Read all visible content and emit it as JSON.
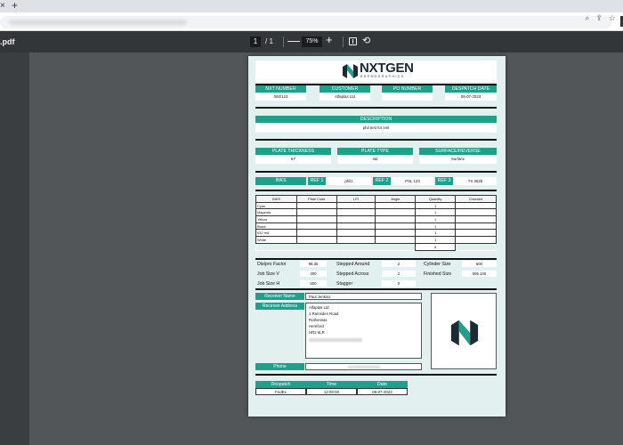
{
  "browser": {
    "new_tab_glyph": "+",
    "close_glyph": "×",
    "icons": [
      "zoom-icon",
      "share-icon",
      "star-icon"
    ]
  },
  "pdf_toolbar": {
    "file_name": ".pdf",
    "page_current": "1",
    "page_total": "/ 1",
    "zoom_minus": "—",
    "zoom_level": "75%",
    "zoom_plus": "+"
  },
  "document": {
    "brand": {
      "name": "NXTGEN",
      "tagline": "REPROGRAPHICS"
    },
    "header_fields": [
      {
        "label": "NXT NUMBER",
        "value": "000/123"
      },
      {
        "label": "CUSTOMER",
        "value": "Alfaplas Ltd"
      },
      {
        "label": "PO NUMBER",
        "value": ""
      },
      {
        "label": "DESPATCH DATE",
        "value": "06-07-2023"
      }
    ],
    "description": {
      "label": "DESCRIPTION",
      "value": "phil test for xml"
    },
    "plate_fields": [
      {
        "label": "PLATE THICKNESS",
        "value": "67"
      },
      {
        "label": "PLATE TYPE",
        "value": "std"
      },
      {
        "label": "SURFACE/REVERSE",
        "value": "Surface"
      }
    ],
    "inks_bar": {
      "label": "INKS",
      "refs": [
        {
          "label": "REF 1",
          "value": "phil1"
        },
        {
          "label": "REF 2",
          "value": "PSL 123"
        },
        {
          "label": "REF 3",
          "value": "TX 3625"
        }
      ]
    },
    "inks_table": {
      "headers": [
        "INKS",
        "Plate Code",
        "LPI",
        "Angle",
        "Quantity",
        "Checked"
      ],
      "rows": [
        [
          "Cyan",
          "",
          "",
          "",
          "1",
          ""
        ],
        [
          "Magenta",
          "",
          "",
          "",
          "1",
          ""
        ],
        [
          "Yellow",
          "",
          "",
          "",
          "1",
          ""
        ],
        [
          "Black",
          "",
          "",
          "",
          "1",
          ""
        ],
        [
          "032 red",
          "",
          "",
          "",
          "1",
          ""
        ],
        [
          "White",
          "",
          "",
          "",
          "1",
          ""
        ]
      ],
      "total_quantity": "6"
    },
    "specs": [
      {
        "label": "Distpro Factor",
        "value": "98.35"
      },
      {
        "label": "Stepped Around",
        "value": "2"
      },
      {
        "label": "Cylinder Size",
        "value": "600"
      },
      {
        "label": "Job Size V",
        "value": "300"
      },
      {
        "label": "Stepped Across",
        "value": "2"
      },
      {
        "label": "Finished Size",
        "value": "595.100"
      },
      {
        "label": "Job Size H",
        "value": "500"
      },
      {
        "label": "Stagger",
        "value": "0"
      }
    ],
    "receiver": {
      "name_label": "Receiver Name",
      "name": "Paul Jenkins",
      "address_label": "Receiver Address",
      "address_lines": [
        "Alfaplas Ltd",
        "1 Ramsden Road",
        "Rotherwas",
        "Hereford",
        "HR2 6LR"
      ],
      "phone_label": "Phone"
    },
    "despatch_table": {
      "headers": [
        "Despatch",
        "Time",
        "Date"
      ],
      "row": [
        "FedEx",
        "12:00:00",
        "06-07-2023"
      ]
    }
  },
  "colors": {
    "teal": "#1fa08a",
    "page_bg": "#e2f0ef",
    "logo_dark": "#1b2a33"
  }
}
